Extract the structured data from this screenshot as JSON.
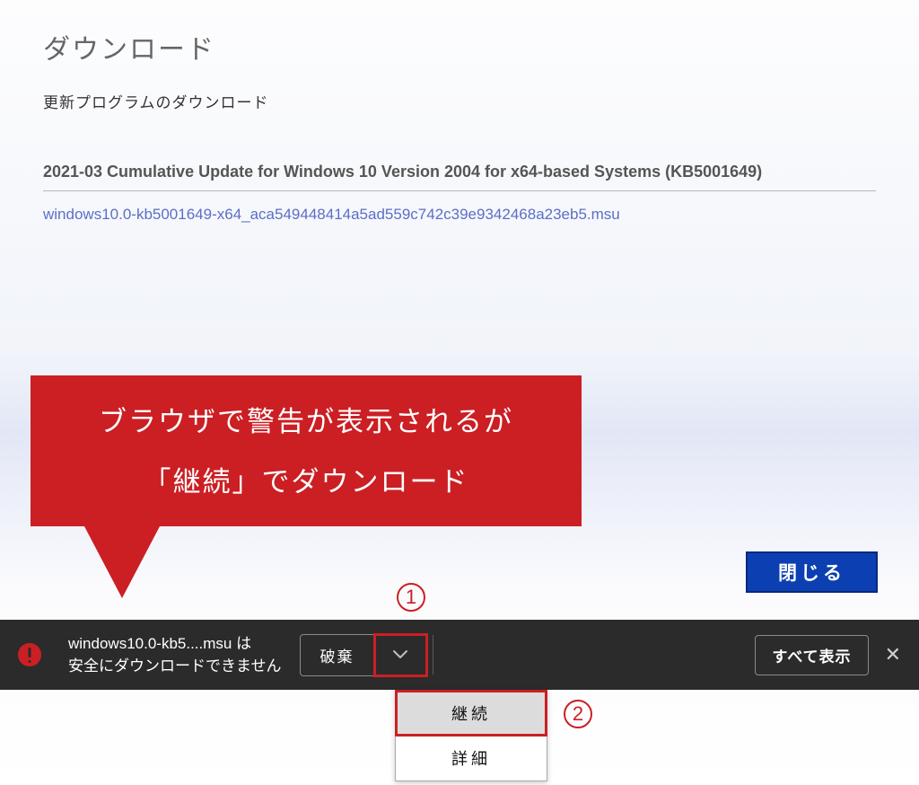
{
  "page": {
    "title": "ダウンロード",
    "subtitle": "更新プログラムのダウンロード",
    "update_title": "2021-03 Cumulative Update for Windows 10 Version 2004 for x64-based Systems (KB5001649)",
    "download_link": "windows10.0-kb5001649-x64_aca549448414a5ad559c742c39e9342468a23eb5.msu"
  },
  "callout": {
    "line1": "ブラウザで警告が表示されるが",
    "line2": "「継続」でダウンロード"
  },
  "buttons": {
    "close_page": "閉じる"
  },
  "steps": {
    "s1": "1",
    "s2": "2"
  },
  "download_bar": {
    "filename_line": "windows10.0-kb5....msu は",
    "warning_line": "安全にダウンロードできません",
    "discard": "破棄",
    "show_all": "すべて表示"
  },
  "dropdown": {
    "continue": "継続",
    "details": "詳細"
  }
}
